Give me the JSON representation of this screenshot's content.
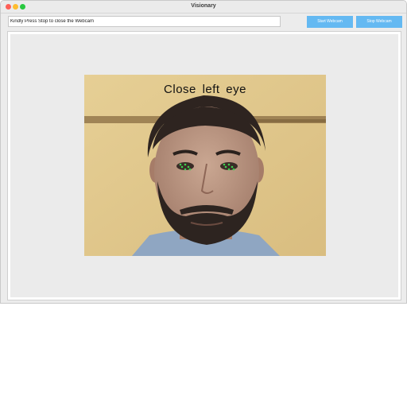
{
  "window": {
    "title": "Visionary"
  },
  "status": {
    "value": "Kindly Press Stop to close the Webcam"
  },
  "controls": {
    "start_label": "Start Webcam",
    "stop_label": "Stop Webcam"
  },
  "video": {
    "overlay_text": "Close left eye"
  },
  "colors": {
    "button_bg": "#64b9f2",
    "landmark_marker": "#3fcf4f"
  }
}
